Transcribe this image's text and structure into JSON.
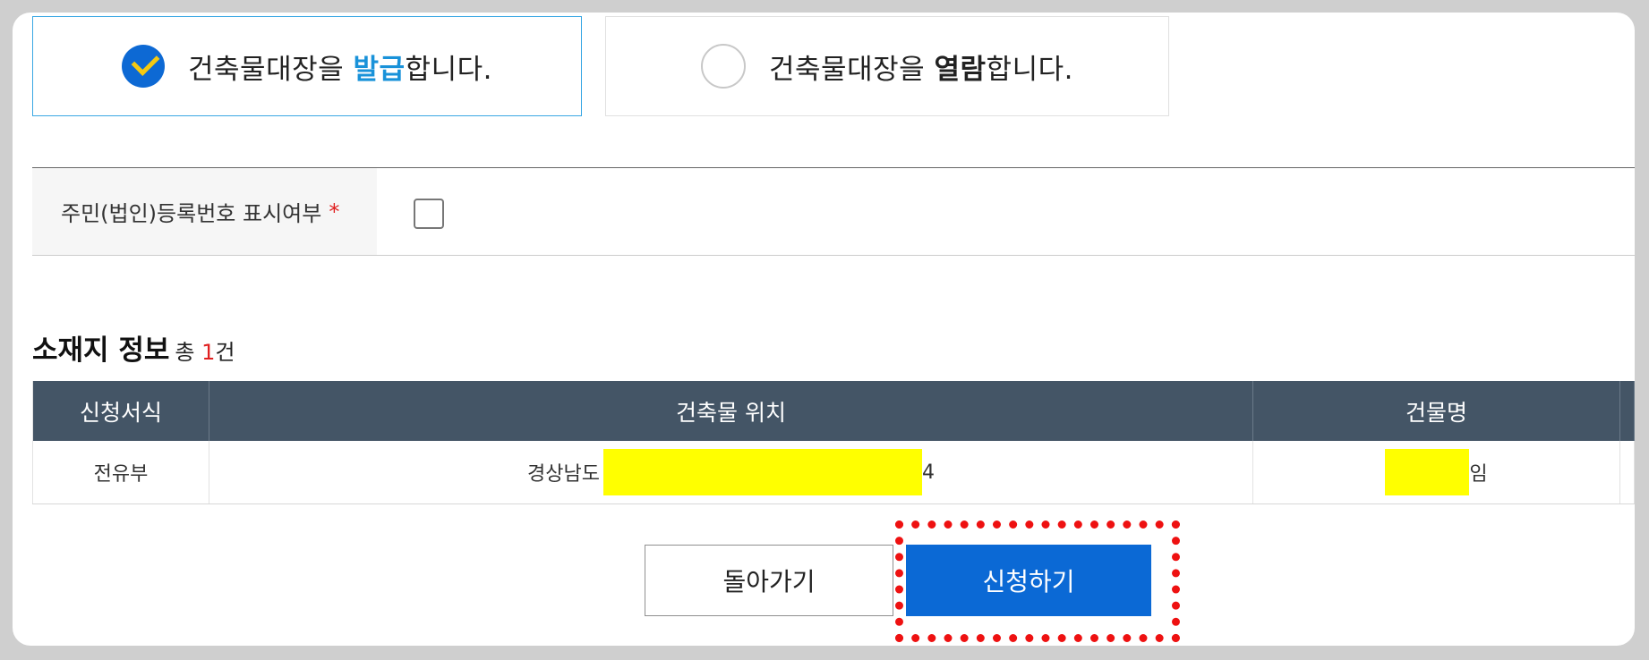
{
  "options": {
    "issue": {
      "prefix": "건축물대장을 ",
      "highlight": "발급",
      "suffix": "합니다.",
      "selected": true
    },
    "view": {
      "prefix": "건축물대장을 ",
      "highlight": "열람",
      "suffix": "합니다.",
      "selected": false
    }
  },
  "resident_number": {
    "label": "주민(법인)등록번호 표시여부",
    "required_mark": "*",
    "checked": false
  },
  "location_section": {
    "title": "소재지 정보",
    "total_prefix": "총 ",
    "count": "1",
    "total_suffix": "건"
  },
  "table": {
    "headers": [
      "신청서식",
      "건축물 위치",
      "건물명"
    ],
    "rows": [
      {
        "form": "전유부",
        "location_prefix": "경상남도",
        "location_suffix": "4",
        "building_suffix": "임"
      }
    ]
  },
  "buttons": {
    "back": "돌아가기",
    "apply": "신청하기"
  },
  "colors": {
    "accent_blue": "#0b69d5",
    "highlight_blue": "#1992d9",
    "table_header": "#445566",
    "required_red": "#e02020",
    "mask_yellow": "#ffff00",
    "focus_red": "#ee1111"
  }
}
